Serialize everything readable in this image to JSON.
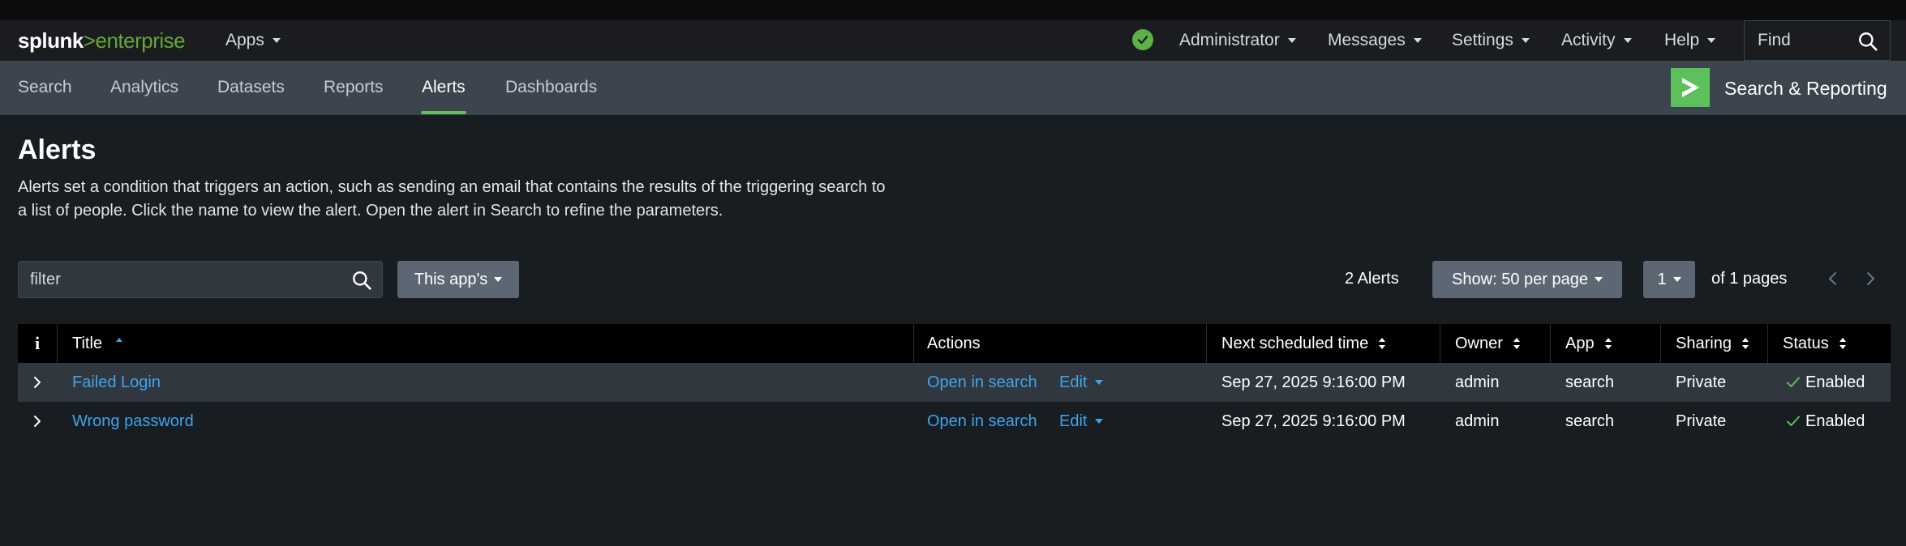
{
  "brand": {
    "part1": "splunk",
    "part2": ">enterprise"
  },
  "appbar": {
    "apps_label": "Apps",
    "menus": [
      "Administrator",
      "Messages",
      "Settings",
      "Activity",
      "Help"
    ],
    "find_placeholder": "Find"
  },
  "nav": {
    "tabs": [
      "Search",
      "Analytics",
      "Datasets",
      "Reports",
      "Alerts",
      "Dashboards"
    ],
    "active_tab": "Alerts",
    "app_name": "Search & Reporting"
  },
  "page": {
    "title": "Alerts",
    "description": "Alerts set a condition that triggers an action, such as sending an email that contains the results of the triggering search to a list of people. Click the name to view the alert. Open the alert in Search to refine the parameters."
  },
  "controls": {
    "filter_placeholder": "filter",
    "scope_button": "This app's",
    "count_label": "2 Alerts",
    "per_page_button": "Show: 50 per page",
    "page_button": "1",
    "pages_label": "of 1 pages"
  },
  "table": {
    "info_header": "i",
    "columns": {
      "title": "Title",
      "actions": "Actions",
      "next_scheduled": "Next scheduled time",
      "owner": "Owner",
      "app": "App",
      "sharing": "Sharing",
      "status": "Status"
    },
    "rows": [
      {
        "title": "Failed Login",
        "open_in_search": "Open in search",
        "edit": "Edit",
        "next_scheduled": "Sep 27, 2025 9:16:00 PM",
        "owner": "admin",
        "app": "search",
        "sharing": "Private",
        "status": "Enabled"
      },
      {
        "title": "Wrong password",
        "open_in_search": "Open in search",
        "edit": "Edit",
        "next_scheduled": "Sep 27, 2025 9:16:00 PM",
        "owner": "admin",
        "app": "search",
        "sharing": "Private",
        "status": "Enabled"
      }
    ]
  },
  "colors": {
    "accent_green": "#5cc05c",
    "link_blue": "#3fa4ec",
    "health_ok": "#5cb247"
  }
}
